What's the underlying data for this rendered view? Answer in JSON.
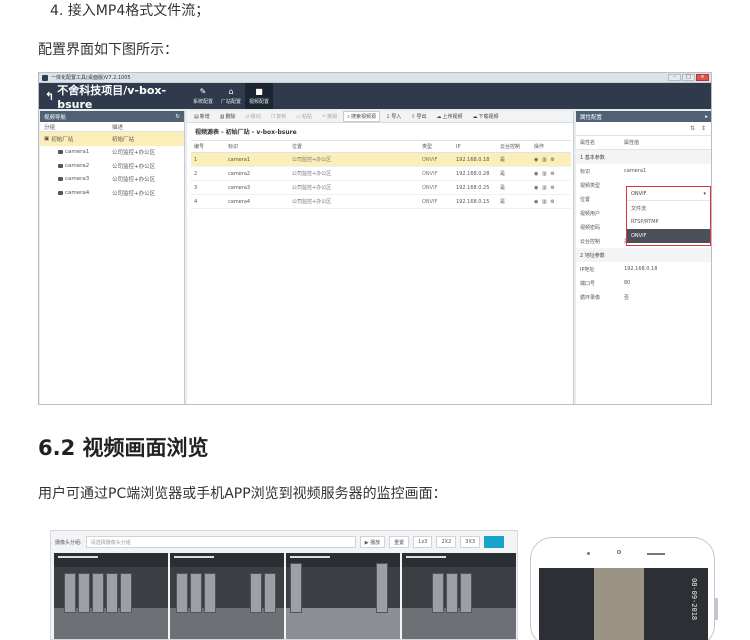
{
  "doc": {
    "list_item_4": "4. 接入MP4格式文件流；",
    "config_intro": "配置界面如下图所示：",
    "section_heading": "6.2 视频画面浏览",
    "section_desc": "用户可通过PC端浏览器或手机APP浏览到视频服务器的监控画面："
  },
  "app": {
    "window_title": "一体化配置工具(桌面版)V7.2.1005",
    "header_title": "不舍科技项目/v-box-bsure",
    "nav_tabs": [
      {
        "label": "系统配置",
        "icon": "wrench-icon"
      },
      {
        "label": "厂站配置",
        "icon": "home-icon"
      },
      {
        "label": "视频配置",
        "icon": "video-icon"
      }
    ],
    "left_panel": {
      "title": "视频导航",
      "col_group": "分组",
      "col_desc": "描述",
      "tree": [
        {
          "name": "初始厂站",
          "desc": "初始厂站",
          "selected": true
        },
        {
          "name": "camera1",
          "desc": "公司监控+办公区"
        },
        {
          "name": "camera2",
          "desc": "公司监控+办公区"
        },
        {
          "name": "camera3",
          "desc": "公司监控+办公区"
        },
        {
          "name": "camera4",
          "desc": "公司监控+办公区"
        }
      ]
    },
    "toolbar": {
      "new": "新增",
      "delete": "删除",
      "move": "移动",
      "copy": "复制",
      "paste": "粘贴",
      "undo": "撤销",
      "search": "搜索视频源",
      "import": "导入",
      "export": "导出",
      "upload": "上传视频",
      "download": "下载视频"
    },
    "main": {
      "crumb": "视频源表 - 初始厂站 - v-box-bsure",
      "columns": [
        "编号",
        "标识",
        "位置",
        "类型",
        "IP",
        "云台控制",
        "操作"
      ],
      "rows": [
        {
          "no": "1",
          "id": "camera1",
          "pos": "公司监控+办公区",
          "type": "ONVIF",
          "ip": "192.168.0.18",
          "ptz": "是",
          "selected": true
        },
        {
          "no": "2",
          "id": "camera2",
          "pos": "公司监控+办公区",
          "type": "ONVIF",
          "ip": "192.168.0.28",
          "ptz": "是"
        },
        {
          "no": "3",
          "id": "camera3",
          "pos": "公司监控+办公区",
          "type": "ONVIF",
          "ip": "192.168.0.25",
          "ptz": "是"
        },
        {
          "no": "4",
          "id": "camera4",
          "pos": "公司监控+办公区",
          "type": "ONVIF",
          "ip": "192.168.0.15",
          "ptz": "是"
        }
      ]
    },
    "right_panel": {
      "title": "属性配置",
      "col_name": "属性名",
      "col_value": "属性值",
      "group1": "1 基本参数",
      "props1": [
        {
          "name": "标识",
          "value": "camera1"
        },
        {
          "name": "视频类型",
          "value": "ONVIF"
        },
        {
          "name": "位置",
          "value": ""
        },
        {
          "name": "视频用户",
          "value": ""
        },
        {
          "name": "视频密码",
          "value": ""
        },
        {
          "name": "云台控制",
          "value": "是"
        }
      ],
      "group2": "2 地址参数",
      "props2": [
        {
          "name": "IP地址",
          "value": "192.168.0.18"
        },
        {
          "name": "端口号",
          "value": "80"
        },
        {
          "name": "循环录像",
          "value": "否"
        }
      ],
      "dropdown": {
        "value": "ONVIF",
        "options": [
          "文件流",
          "RTSP/RTMP",
          "ONVIF"
        ]
      }
    }
  },
  "video_app": {
    "label": "摄像头分组:",
    "placeholder": "请选择摄像头分组",
    "play": "▶ 播放",
    "layouts": [
      "重置",
      "1x3",
      "2X2",
      "3X3"
    ]
  },
  "phone": {
    "timestamp": "08-09-2018"
  }
}
